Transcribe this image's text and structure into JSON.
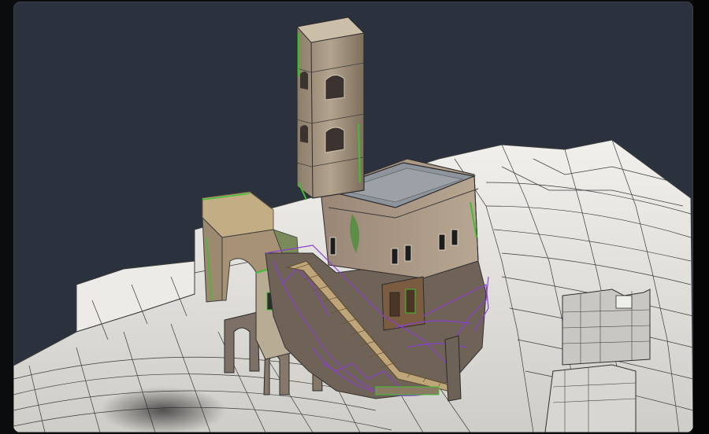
{
  "viewport": {
    "background": "#2c323d",
    "content": "3d-wireframe-scene"
  },
  "scene": {
    "colors": {
      "terrain": "#e9e8e4",
      "wire": "#2b2b2b",
      "stone": "#9a8a78",
      "stone_light": "#bfb29e",
      "roof": "#8d949b",
      "vegetation": "#3fbf2f",
      "selection": "#8a3fd0"
    }
  }
}
